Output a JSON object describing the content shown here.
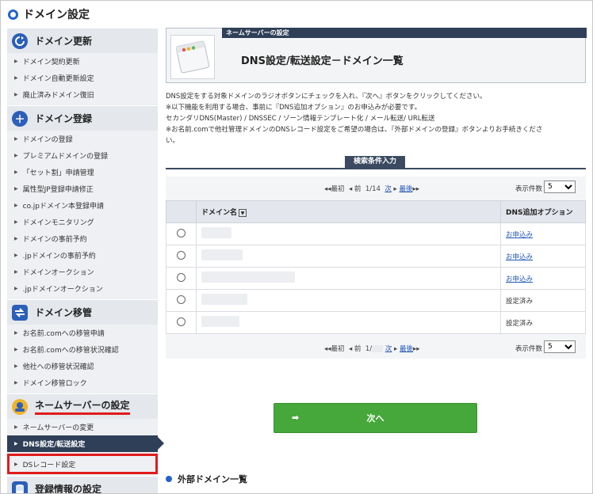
{
  "header": {
    "title": "ドメイン設定"
  },
  "sidebar": {
    "sections": [
      {
        "title": "ドメイン更新",
        "icon": "refresh-icon",
        "items": [
          "ドメイン契約更新",
          "ドメイン自動更新設定",
          "廃止済みドメイン復旧"
        ]
      },
      {
        "title": "ドメイン登録",
        "icon": "plus-icon",
        "items": [
          "ドメインの登録",
          "プレミアムドメインの登録",
          "「セット割」申請管理",
          "属性型JP登録申請修正",
          "co.jpドメイン本登録申請",
          "ドメインモニタリング",
          "ドメインの事前予約",
          ".jpドメインの事前予約",
          "ドメインオークション",
          ".jpドメインオークション"
        ]
      },
      {
        "title": "ドメイン移管",
        "icon": "transfer-icon",
        "items": [
          "お名前.comへの移管申請",
          "お名前.comへの移管状況確認",
          "他社への移管状況確認",
          "ドメイン移管ロック"
        ]
      },
      {
        "title": "ネームサーバーの設定",
        "icon": "nameserver-icon",
        "items": [
          "ネームサーバーの変更",
          "DNS設定/転送設定",
          "DSレコード設定"
        ]
      },
      {
        "title": "登録情報の設定",
        "icon": "database-icon",
        "items": []
      }
    ]
  },
  "panel": {
    "tab": "ネームサーバーの設定",
    "heading": "DNS設定/転送設定－ドメイン一覧"
  },
  "description": [
    "DNS設定をする対象ドメインのラジオボタンにチェックを入れ、『次へ』ボタンをクリックしてください。",
    "※以下機能を利用する場合、事前に『DNS追加オプション』のお申込みが必要です。",
    "セカンダリDNS(Master) / DNSSEC / ゾーン情報テンプレート化 / メール転送/ URL転送",
    "※お名前.comで他社管理ドメインのDNSレコード設定をご希望の場合は、『外部ドメインの登録』ボタンよりお手続きくださ",
    "い。"
  ],
  "search": {
    "tab_label": "検索条件入力"
  },
  "pager_top": {
    "first": "◂◂最初",
    "prev": "◂ 前",
    "page": "1/14",
    "next": "次",
    "last": "最後",
    "count_label": "表示件数",
    "count_value": "5"
  },
  "pager_bottom": {
    "first": "◂◂最初",
    "prev": "◂ 前",
    "page": "1/",
    "next": "次",
    "last": "最後",
    "count_label": "表示件数",
    "count_value": "5"
  },
  "table": {
    "headers": [
      "ドメイン名",
      "DNS追加オプション"
    ],
    "rows": [
      {
        "option": "お申込み",
        "link": true
      },
      {
        "option": "お申込み",
        "link": true
      },
      {
        "option": "お申込み",
        "link": true
      },
      {
        "option": "設定済み",
        "link": false
      },
      {
        "option": "設定済み",
        "link": false
      }
    ]
  },
  "next_button": {
    "label": "次へ",
    "arrow": "➡"
  },
  "external": {
    "heading": "外部ドメイン一覧"
  },
  "colors": {
    "accent": "#2563c9",
    "nav_dark": "#2f3f57",
    "highlight": "#e21b1b",
    "next_green": "#46a83b"
  }
}
